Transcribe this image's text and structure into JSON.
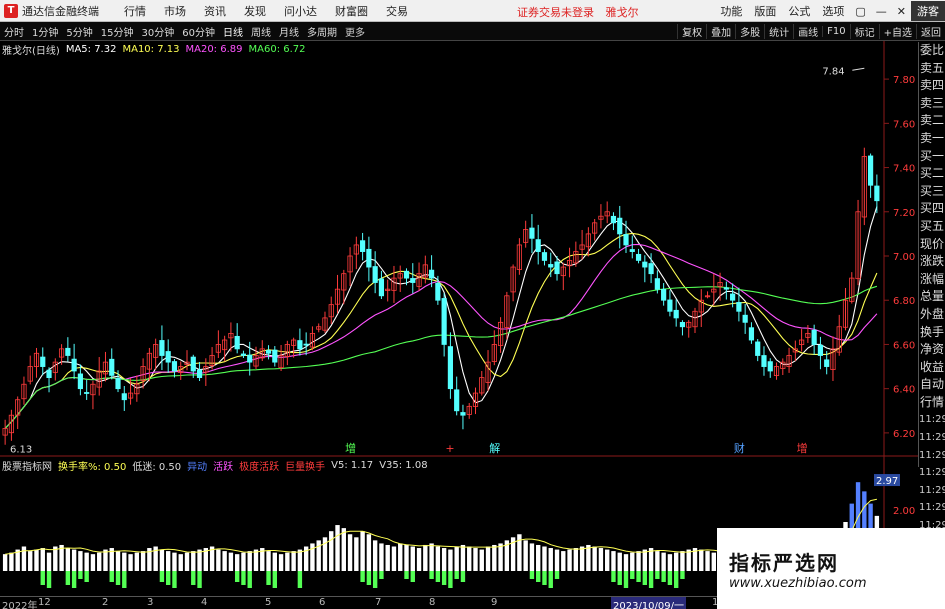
{
  "app": {
    "title": "通达信金融终端",
    "menu": [
      "行情",
      "市场",
      "资讯",
      "发现",
      "问小达",
      "财富圈",
      "交易"
    ],
    "notice": "证券交易未登录",
    "stock_name_title": "雅戈尔",
    "right_menu": [
      "功能",
      "版面",
      "公式",
      "选项"
    ],
    "window_controls": [
      "▢",
      "—",
      "✕"
    ],
    "guest": "游客"
  },
  "toolbar": {
    "periods": [
      "分时",
      "1分钟",
      "5分钟",
      "15分钟",
      "30分钟",
      "60分钟",
      "日线",
      "周线",
      "月线",
      "多周期",
      "更多"
    ],
    "active_period": "日线",
    "tools": [
      "复权",
      "叠加",
      "多股",
      "统计",
      "画线",
      "F10",
      "标记",
      "+自选",
      "返回"
    ]
  },
  "legend": {
    "title": "雅戈尔(日线)",
    "ma5": "MA5: 7.32",
    "ma10": "MA10: 7.13",
    "ma20": "MA20: 6.89",
    "ma60": "MA60: 6.72"
  },
  "colors": {
    "up": "#ff3c3c",
    "down": "#54ffff",
    "ma5": "#ffffff",
    "ma10": "#ffff54",
    "ma20": "#ff54ff",
    "ma60": "#54ff54",
    "axis": "#8b1a1a",
    "bg": "#000000"
  },
  "sidebar": {
    "labels": [
      "委比",
      "卖五",
      "卖四",
      "卖三",
      "卖二",
      "卖一",
      "买一",
      "买二",
      "买三",
      "买四",
      "买五",
      "现价",
      "涨跌",
      "涨幅",
      "总量",
      "外盘",
      "换手",
      "净资",
      "收益",
      "自动",
      "行情"
    ],
    "times": [
      "11:29",
      "11:29",
      "11:29",
      "11:29",
      "11:29",
      "11:29",
      "11:29"
    ]
  },
  "chart_data": {
    "type": "candlestick",
    "title": "雅戈尔(日线)",
    "ylim": [
      6.1,
      7.9
    ],
    "yticks": [
      6.2,
      6.4,
      6.6,
      6.8,
      7.0,
      7.2,
      7.4,
      7.6,
      7.8
    ],
    "ytick_labels": [
      "6.20",
      "6.40",
      "6.60",
      "6.80",
      "7.00",
      "7.20",
      "7.40",
      "7.60",
      "7.80"
    ],
    "max_label": "7.84",
    "min_label": "6.13",
    "closes": [
      6.22,
      6.28,
      6.35,
      6.42,
      6.5,
      6.56,
      6.5,
      6.45,
      6.52,
      6.58,
      6.55,
      6.48,
      6.4,
      6.38,
      6.42,
      6.48,
      6.52,
      6.46,
      6.4,
      6.35,
      6.38,
      6.42,
      6.5,
      6.56,
      6.6,
      6.55,
      6.52,
      6.48,
      6.5,
      6.52,
      6.48,
      6.45,
      6.5,
      6.55,
      6.6,
      6.62,
      6.65,
      6.58,
      6.55,
      6.52,
      6.55,
      6.58,
      6.56,
      6.52,
      6.55,
      6.6,
      6.62,
      6.58,
      6.6,
      6.65,
      6.68,
      6.72,
      6.78,
      6.85,
      6.92,
      7.0,
      7.05,
      7.02,
      6.95,
      6.88,
      6.82,
      6.85,
      6.9,
      6.92,
      6.9,
      6.88,
      6.92,
      6.96,
      6.9,
      6.8,
      6.6,
      6.4,
      6.3,
      6.28,
      6.32,
      6.38,
      6.45,
      6.52,
      6.6,
      6.7,
      6.82,
      6.95,
      7.05,
      7.12,
      7.08,
      7.02,
      6.98,
      6.95,
      6.92,
      6.95,
      6.98,
      7.02,
      7.05,
      7.1,
      7.15,
      7.18,
      7.2,
      7.15,
      7.1,
      7.05,
      7.02,
      6.98,
      6.95,
      6.92,
      6.85,
      6.8,
      6.75,
      6.72,
      6.68,
      6.7,
      6.75,
      6.8,
      6.82,
      6.85,
      6.88,
      6.85,
      6.8,
      6.75,
      6.7,
      6.62,
      6.55,
      6.5,
      6.48,
      6.5,
      6.52,
      6.55,
      6.58,
      6.62,
      6.65,
      6.6,
      6.55,
      6.5,
      6.58,
      6.68,
      6.8,
      6.9,
      7.2,
      7.45,
      7.32,
      7.25
    ],
    "events": [
      {
        "label": "增",
        "color": "#54ff54",
        "index": 55
      },
      {
        "label": "+",
        "color": "#ff3c3c",
        "index": 71
      },
      {
        "label": "解",
        "color": "#54ffff",
        "index": 78
      },
      {
        "label": "财",
        "color": "#54a0ff",
        "index": 117
      },
      {
        "label": "增",
        "color": "#ff3c3c",
        "index": 127
      }
    ],
    "sub": {
      "title": "股票指标网",
      "turnover_label": "换手率%: 0.50",
      "low_label": "低迷: 0.50",
      "tags": [
        "异动",
        "活跃",
        "极度活跃",
        "巨量换手"
      ],
      "tag_colors": [
        "#5480ff",
        "#ff54ff",
        "#ff3c3c",
        "#ff3c3c"
      ],
      "v5": "V5: 1.17",
      "v35": "V35: 1.08",
      "ylabels": [
        "2.97",
        "2.00"
      ],
      "volumes": [
        0.55,
        0.6,
        0.7,
        0.8,
        0.65,
        0.7,
        0.75,
        0.6,
        0.8,
        0.85,
        0.75,
        0.7,
        0.65,
        0.6,
        0.55,
        0.6,
        0.7,
        0.75,
        0.65,
        0.6,
        0.55,
        0.6,
        0.65,
        0.75,
        0.8,
        0.7,
        0.65,
        0.6,
        0.55,
        0.6,
        0.65,
        0.7,
        0.75,
        0.8,
        0.7,
        0.65,
        0.6,
        0.55,
        0.6,
        0.65,
        0.7,
        0.75,
        0.65,
        0.6,
        0.55,
        0.6,
        0.65,
        0.7,
        0.8,
        0.9,
        1.0,
        1.1,
        1.3,
        1.5,
        1.4,
        1.2,
        1.1,
        1.3,
        1.2,
        1.0,
        0.9,
        0.85,
        0.8,
        0.9,
        0.85,
        0.8,
        0.75,
        0.85,
        0.9,
        0.8,
        0.75,
        0.7,
        0.8,
        0.85,
        0.8,
        0.75,
        0.7,
        0.8,
        0.85,
        0.9,
        1.0,
        1.1,
        1.2,
        1.0,
        0.9,
        0.85,
        0.8,
        0.75,
        0.7,
        0.65,
        0.7,
        0.75,
        0.8,
        0.85,
        0.8,
        0.75,
        0.7,
        0.65,
        0.6,
        0.55,
        0.6,
        0.65,
        0.7,
        0.75,
        0.65,
        0.6,
        0.55,
        0.6,
        0.65,
        0.7,
        0.75,
        0.7,
        0.65,
        0.6,
        0.55,
        0.5,
        0.55,
        0.6,
        0.65,
        0.7,
        0.65,
        0.6,
        0.55,
        0.5,
        0.55,
        0.6,
        0.65,
        0.7,
        0.75,
        0.8,
        0.75,
        0.7,
        0.9,
        1.2,
        1.6,
        2.2,
        2.9,
        2.6,
        2.2,
        1.8
      ]
    },
    "xlabels": [
      "2022年",
      "12",
      "2",
      "3",
      "4",
      "5",
      "6",
      "7",
      "8",
      "9",
      "2023/10/09/一",
      "11"
    ]
  },
  "watermark": {
    "line1": "指标严选网",
    "line2": "www.xuezhibiao.com"
  }
}
